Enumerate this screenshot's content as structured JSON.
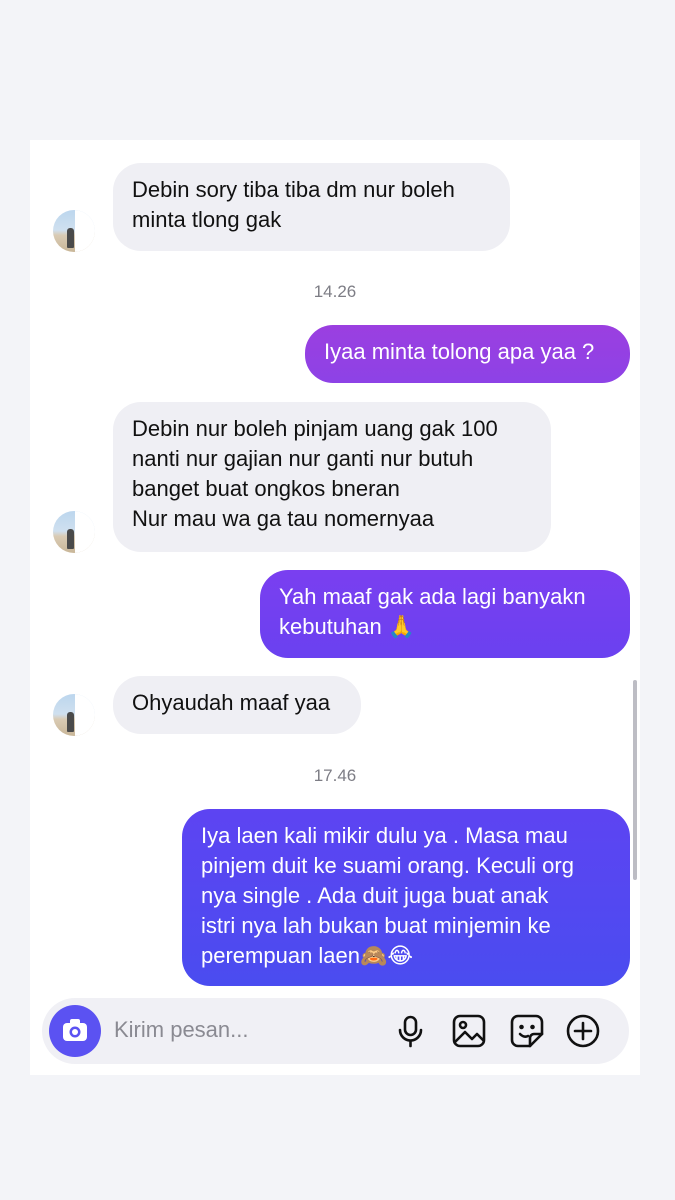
{
  "messages": [
    {
      "side": "in",
      "text": "Debin sory tiba tiba dm nur boleh\nminta tlong gak"
    },
    {
      "timestamp": "14.26"
    },
    {
      "side": "out",
      "text": "Iyaa minta tolong apa yaa ?"
    },
    {
      "side": "in",
      "text": "Debin nur boleh pinjam uang gak 100\nnanti nur gajian nur ganti nur butuh\nbanget buat ongkos bneran\nNur mau wa ga tau nomernyaa"
    },
    {
      "side": "out",
      "text": "Yah maaf gak ada lagi banyakn\nkebutuhan 🙏"
    },
    {
      "side": "in",
      "text": "Ohyaudah maaf yaa"
    },
    {
      "timestamp": "17.46"
    },
    {
      "side": "out",
      "text": "Iya laen kali mikir dulu ya . Masa mau\npinjem duit ke suami orang. Keculi org\nnya single . Ada duit juga buat anak\nistri nya lah bukan buat minjemin ke\nperempuan laen🙈😂"
    }
  ],
  "composer": {
    "placeholder": "Kirim pesan...",
    "icons": [
      "camera-icon",
      "microphone-icon",
      "image-icon",
      "sticker-icon",
      "plus-icon"
    ]
  },
  "colors": {
    "incoming_bubble": "#efeff4",
    "outgoing_gradient_top": "#9b3fe0",
    "outgoing_gradient_bottom": "#4a4cf0",
    "camera_button": "#5b52f2"
  }
}
